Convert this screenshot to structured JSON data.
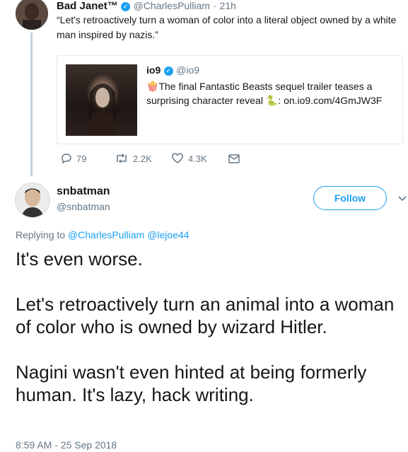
{
  "tweet1": {
    "name": "Bad Janet™",
    "handle": "@CharlesPulliam",
    "separator": "·",
    "time": "21h",
    "text": "“Let's retroactively turn a woman of color into a literal object owned by a white man inspired by nazis.”"
  },
  "quote": {
    "name": "io9",
    "handle": "@io9",
    "emoji": "🍿",
    "text_line1": "The final Fantastic Beasts sequel trailer teases a",
    "text_line2_pre": "surprising character reveal ",
    "emoji2": "🐍",
    "text_line2_post": ": on.io9.com/4GmJW3F"
  },
  "actions": {
    "replies": "79",
    "retweets": "2.2K",
    "likes": "4.3K"
  },
  "tweet2": {
    "name": "snbatman",
    "handle": "@snbatman",
    "follow_label": "Follow",
    "replying_prefix": "Replying to",
    "replying_to": "@CharlesPulliam @lejoe44",
    "text": "It's even worse.\n\nLet's retroactively turn an animal into a woman of color who is owned by wizard Hitler.\n\nNagini wasn't even hinted at being formerly human. It's lazy, hack writing.",
    "timestamp": "8:59 AM - 25 Sep 2018"
  },
  "colors": {
    "accent": "#1da1f2",
    "secondary_text": "#657786",
    "thread_line": "#c6d3dd"
  },
  "icons": [
    "verified-icon",
    "reply-icon",
    "retweet-icon",
    "like-icon",
    "dm-icon",
    "chevron-down-icon",
    "popcorn-icon",
    "snake-icon"
  ]
}
